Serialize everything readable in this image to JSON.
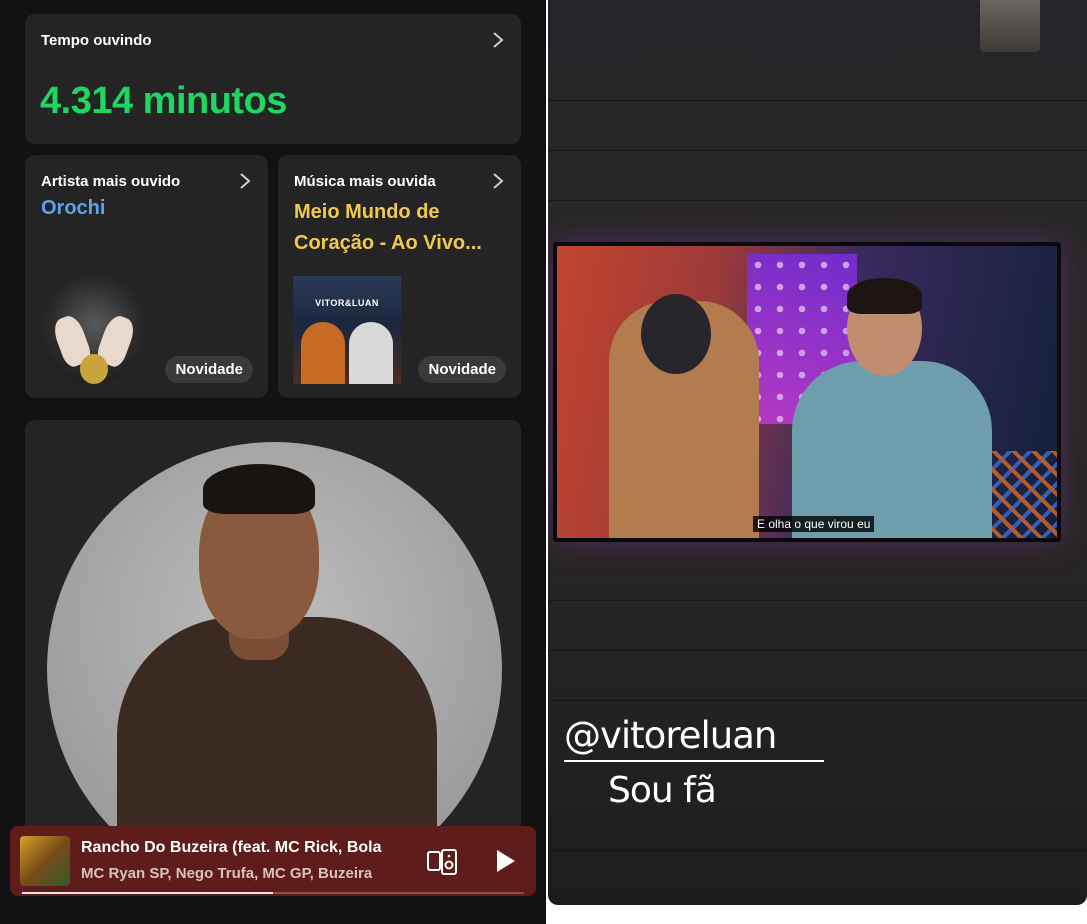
{
  "stats": {
    "time_label": "Tempo ouvindo",
    "time_value": "4.314 minutos",
    "artist_label": "Artista mais ouvido",
    "artist_name": "Orochi",
    "artist_badge": "Novidade",
    "song_label": "Música mais ouvida",
    "song_name": "Meio Mundo de Coração - Ao Vivo...",
    "song_badge": "Novidade",
    "album_art_text": "VITOR&LUAN"
  },
  "player": {
    "title": "Rancho Do Buzeira (feat. MC Rick, Bola",
    "artists": "MC Ryan SP, Nego Trufa, MC GP, Buzeira",
    "progress": 0.5
  },
  "story": {
    "tv_subtitle": "E olha o que virou eu",
    "mention": "@vitoreluan",
    "text": "Sou fã"
  },
  "colors": {
    "accent_green": "#1ed760",
    "artist_blue": "#5ea1f0",
    "song_yellow": "#f2c94c",
    "player_bg": "#5e1d1a"
  },
  "icons": {
    "chevron": "chevron-right-icon",
    "device": "connect-device-icon",
    "play": "play-icon"
  }
}
